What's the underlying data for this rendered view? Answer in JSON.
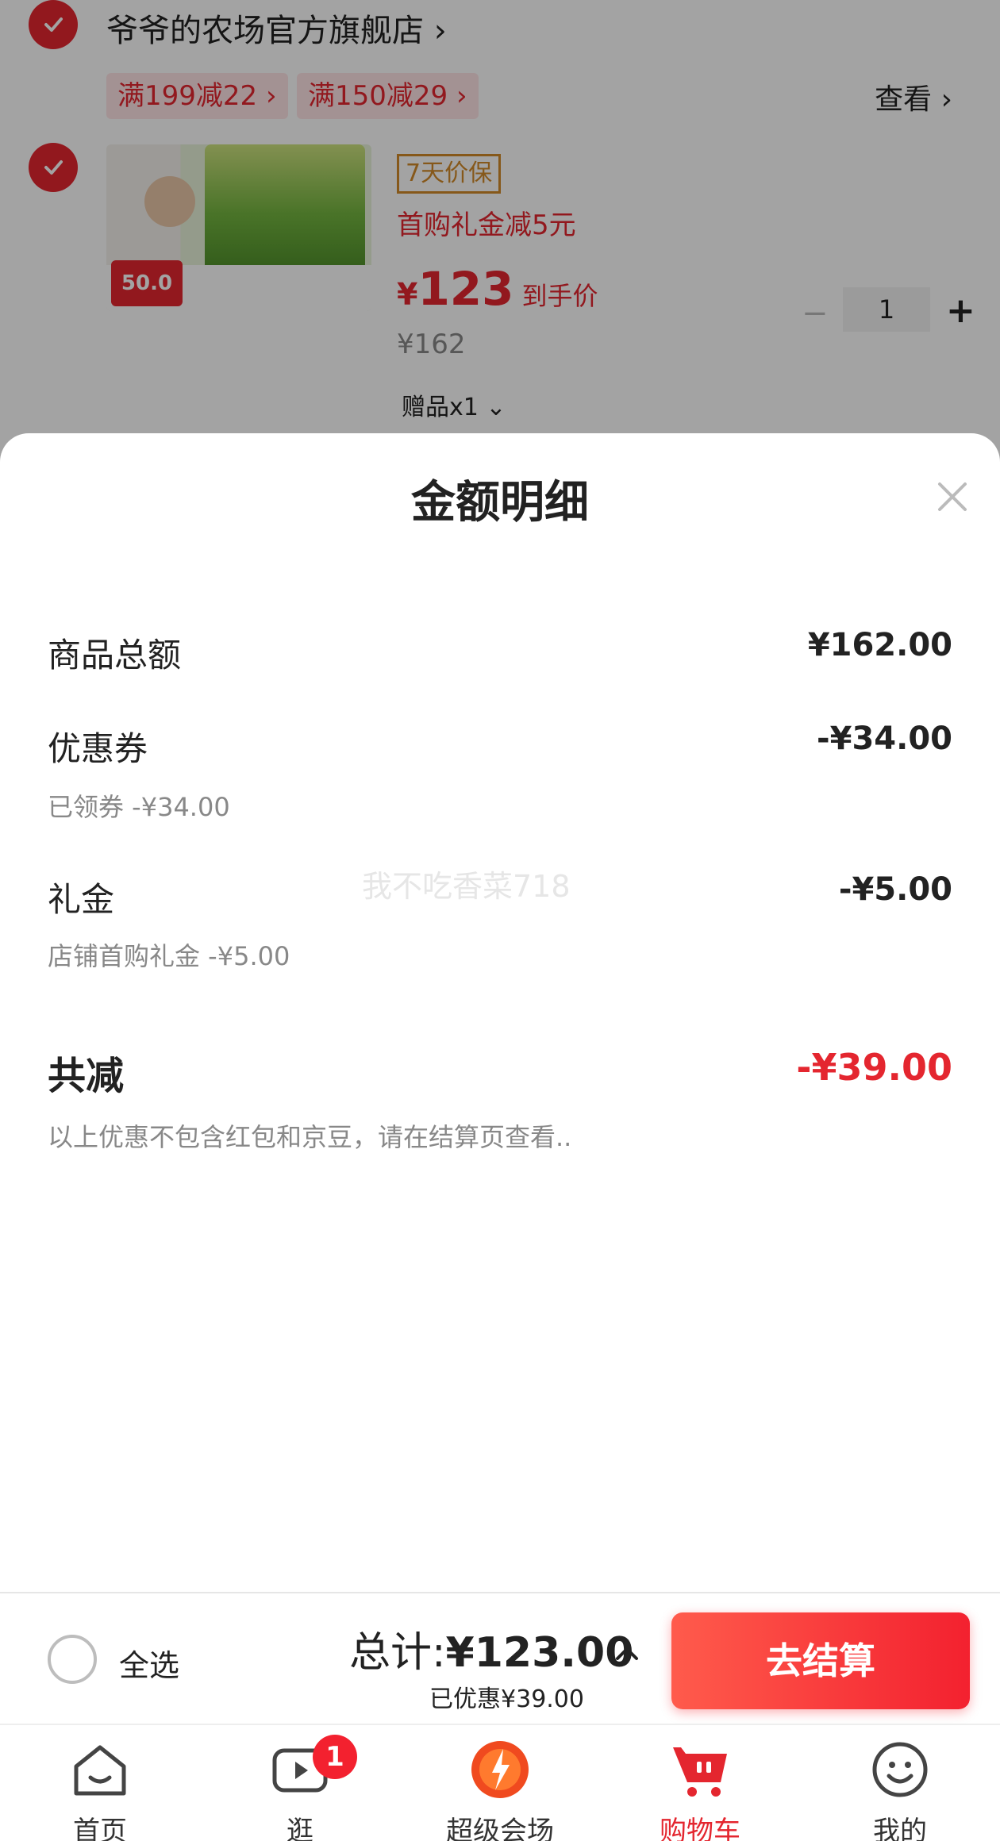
{
  "cart": {
    "shop_name": "爷爷的农场官方旗舰店 ›",
    "promo_tags": [
      "满199减22 ›",
      "满150减29 ›"
    ],
    "view_link": "查看 ›",
    "product": {
      "badge": "7天价保",
      "gift_text": "首购礼金减5元",
      "currency": "¥",
      "price": "123",
      "price_label": "到手价",
      "original_price": "¥162",
      "gift_count": "赠品x1 ⌄",
      "image_badge": "50.0",
      "quantity": "1"
    }
  },
  "sheet": {
    "title": "金额明细",
    "rows": [
      {
        "label": "商品总额",
        "value": "¥162.00",
        "sub": ""
      },
      {
        "label": "优惠券",
        "value": "-¥34.00",
        "sub": "已领券 -¥34.00"
      },
      {
        "label": "礼金",
        "value": "-¥5.00",
        "sub": "店铺首购礼金 -¥5.00"
      }
    ],
    "total_label": "共减",
    "total_value": "-¥39.00",
    "note": "以上优惠不包含红包和京豆，请在结算页查看..",
    "watermark": "我不吃香菜718"
  },
  "checkout": {
    "select_all": "全选",
    "total_prefix": "总计:",
    "total_amount": "¥123.00",
    "saved": "已优惠¥39.00",
    "button": "去结算"
  },
  "tabs": [
    {
      "label": "首页",
      "icon": "home-icon"
    },
    {
      "label": "逛",
      "icon": "video-icon",
      "badge": "1"
    },
    {
      "label": "超级会场",
      "icon": "super-venue-icon"
    },
    {
      "label": "购物车",
      "icon": "cart-icon",
      "active": true
    },
    {
      "label": "我的",
      "icon": "profile-icon"
    }
  ],
  "colors": {
    "accent": "#e4262f",
    "button": "#f3212f",
    "muted": "#888888"
  }
}
